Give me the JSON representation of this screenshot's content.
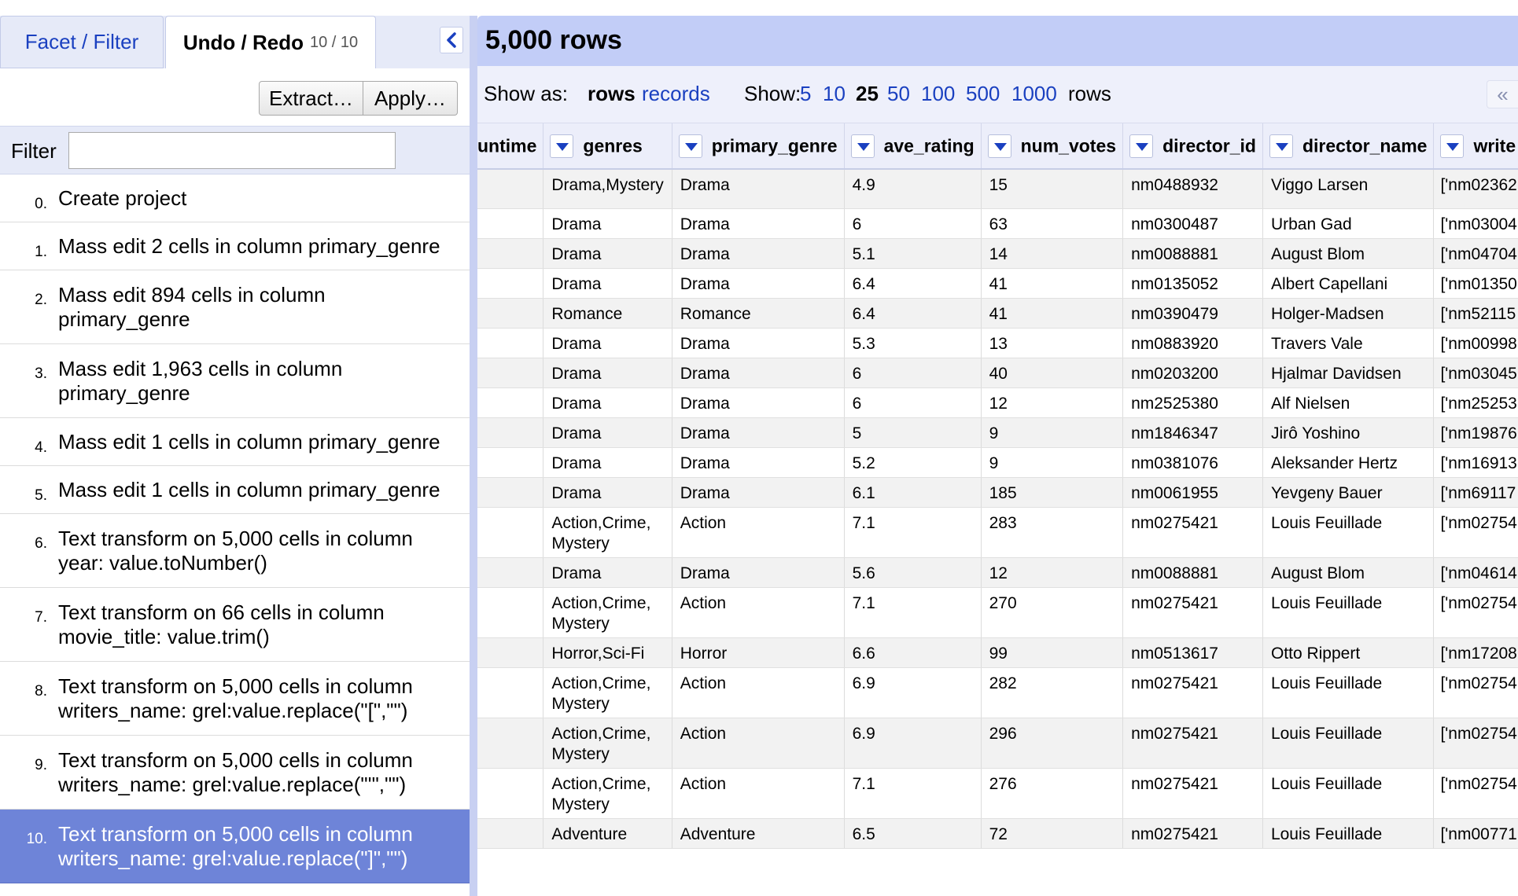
{
  "tabs": {
    "facet_label": "Facet / Filter",
    "undo_label": "Undo / Redo",
    "undo_count": "10 / 10"
  },
  "buttons": {
    "extract": "Extract…",
    "apply": "Apply…"
  },
  "filter": {
    "label": "Filter",
    "value": ""
  },
  "history": [
    {
      "num": "0.",
      "text": "Create project"
    },
    {
      "num": "1.",
      "text": "Mass edit 2 cells in column primary_genre"
    },
    {
      "num": "2.",
      "text": "Mass edit 894 cells in column primary_genre"
    },
    {
      "num": "3.",
      "text": "Mass edit 1,963 cells in column primary_genre"
    },
    {
      "num": "4.",
      "text": "Mass edit 1 cells in column primary_genre"
    },
    {
      "num": "5.",
      "text": "Mass edit 1 cells in column primary_genre"
    },
    {
      "num": "6.",
      "text": "Text transform on 5,000 cells in column year: value.toNumber()"
    },
    {
      "num": "7.",
      "text": "Text transform on 66 cells in column movie_title: value.trim()"
    },
    {
      "num": "8.",
      "text": "Text transform on 5,000 cells in column writers_name: grel:value.replace(\"[\",\"\")"
    },
    {
      "num": "9.",
      "text": "Text transform on 5,000 cells in column writers_name: grel:value.replace(\"'\",\"\")"
    },
    {
      "num": "10.",
      "text": "Text transform on 5,000 cells in column writers_name: grel:value.replace(\"]\",\"\")"
    }
  ],
  "rows_header": {
    "count": "5,000 rows"
  },
  "view_bar": {
    "show_as_label": "Show as:",
    "rows_opt": "rows",
    "records_opt": "records",
    "show_label": "Show:",
    "page_sizes": [
      "5",
      "10",
      "25",
      "50",
      "100",
      "500",
      "1000"
    ],
    "selected_page_size": "25",
    "rows_suffix": "rows",
    "scroll_left": "«"
  },
  "table": {
    "columns": [
      "untime",
      "genres",
      "primary_genre",
      "ave_rating",
      "num_votes",
      "director_id",
      "director_name",
      "write"
    ],
    "rows": [
      [
        "",
        "Drama,Mystery",
        "Drama",
        "4.9",
        "15",
        "nm0488932",
        "Viggo Larsen",
        "['nm02362"
      ],
      [
        "",
        "Drama",
        "Drama",
        "6",
        "63",
        "nm0300487",
        "Urban Gad",
        "['nm03004"
      ],
      [
        "",
        "Drama",
        "Drama",
        "5.1",
        "14",
        "nm0088881",
        "August Blom",
        "['nm04704"
      ],
      [
        "",
        "Drama",
        "Drama",
        "6.4",
        "41",
        "nm0135052",
        "Albert Capellani",
        "['nm01350"
      ],
      [
        "",
        "Romance",
        "Romance",
        "6.4",
        "41",
        "nm0390479",
        "Holger-Madsen",
        "['nm52115"
      ],
      [
        "",
        "Drama",
        "Drama",
        "5.3",
        "13",
        "nm0883920",
        "Travers Vale",
        "['nm00998"
      ],
      [
        "",
        "Drama",
        "Drama",
        "6",
        "40",
        "nm0203200",
        "Hjalmar Davidsen",
        "['nm03045"
      ],
      [
        "",
        "Drama",
        "Drama",
        "6",
        "12",
        "nm2525380",
        "Alf Nielsen",
        "['nm25253"
      ],
      [
        "",
        "Drama",
        "Drama",
        "5",
        "9",
        "nm1846347",
        "Jirô Yoshino",
        "['nm19876"
      ],
      [
        "",
        "Drama",
        "Drama",
        "5.2",
        "9",
        "nm0381076",
        "Aleksander Hertz",
        "['nm16913"
      ],
      [
        "",
        "Drama",
        "Drama",
        "6.1",
        "185",
        "nm0061955",
        "Yevgeny Bauer",
        "['nm69117"
      ],
      [
        "",
        "Action,Crime, Mystery",
        "Action",
        "7.1",
        "283",
        "nm0275421",
        "Louis Feuillade",
        "['nm02754"
      ],
      [
        "",
        "Drama",
        "Drama",
        "5.6",
        "12",
        "nm0088881",
        "August Blom",
        "['nm04614"
      ],
      [
        "",
        "Action,Crime, Mystery",
        "Action",
        "7.1",
        "270",
        "nm0275421",
        "Louis Feuillade",
        "['nm02754"
      ],
      [
        "",
        "Horror,Sci-Fi",
        "Horror",
        "6.6",
        "99",
        "nm0513617",
        "Otto Rippert",
        "['nm17208"
      ],
      [
        "",
        "Action,Crime, Mystery",
        "Action",
        "6.9",
        "282",
        "nm0275421",
        "Louis Feuillade",
        "['nm02754"
      ],
      [
        "",
        "Action,Crime, Mystery",
        "Action",
        "6.9",
        "296",
        "nm0275421",
        "Louis Feuillade",
        "['nm02754"
      ],
      [
        "",
        "Action,Crime, Mystery",
        "Action",
        "7.1",
        "276",
        "nm0275421",
        "Louis Feuillade",
        "['nm02754"
      ],
      [
        "",
        "Adventure",
        "Adventure",
        "6.5",
        "72",
        "nm0275421",
        "Louis Feuillade",
        "['nm00771"
      ]
    ]
  },
  "colors": {
    "link": "#1a40c0",
    "selected_history": "#6e84d8",
    "header_band": "#c2cdf7"
  }
}
